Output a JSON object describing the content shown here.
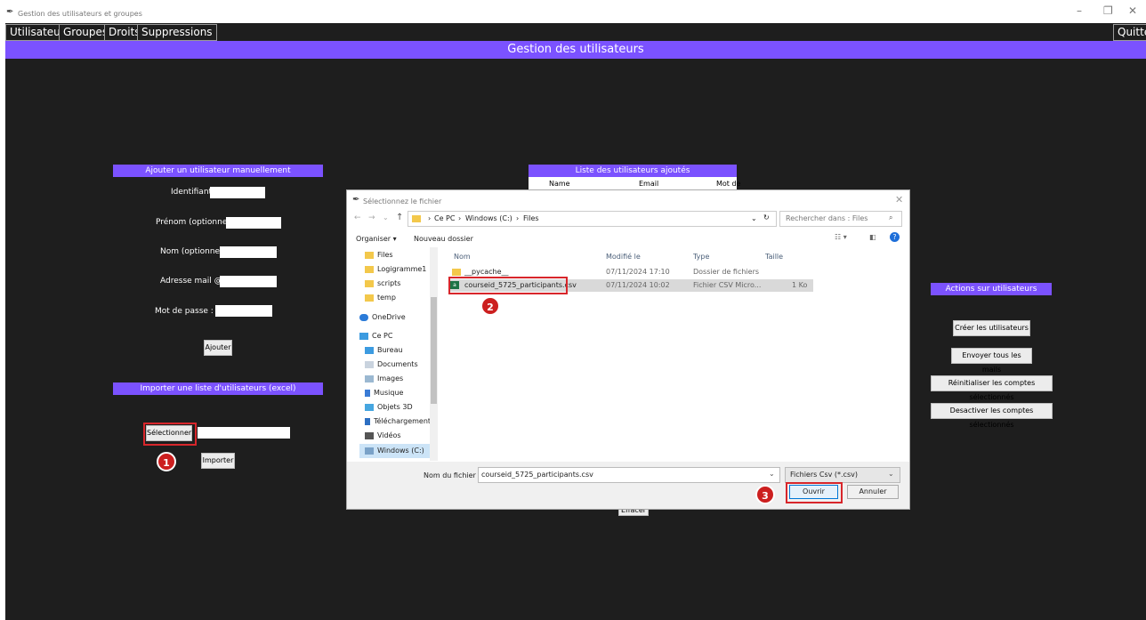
{
  "window": {
    "title": "Gestion des utilisateurs et groupes",
    "controls": [
      "–",
      "❐",
      "✕"
    ]
  },
  "menu": {
    "items": [
      "Utilisateurs",
      "Groupes",
      "Droits",
      "Suppressions"
    ],
    "quit": "Quitter"
  },
  "banner": "Gestion des utilisateurs",
  "manual": {
    "header": "Ajouter un utilisateur manuellement",
    "fields": {
      "id": "Identifiant :",
      "firstname": "Prénom (optionnel):",
      "lastname": "Nom (optionnel) :",
      "email": "Adresse mail @ :",
      "password": "Mot de passe :"
    },
    "add_button": "Ajouter"
  },
  "import": {
    "header": "Importer une liste d'utilisateurs (excel)",
    "select_button": "Sélectionner",
    "import_button": "Importer"
  },
  "list": {
    "header": "Liste des utilisateurs ajoutés",
    "columns": [
      "Name",
      "Email",
      "Mot de"
    ],
    "clear_button": "Effacer"
  },
  "actions": {
    "header": "Actions sur utilisateurs",
    "buttons": [
      "Créer les utilisateurs",
      "Envoyer tous les mails",
      "Réinitialiser les comptes sélectionnés",
      "Desactiver les comptes sélectionnés"
    ]
  },
  "dialog": {
    "title": "Sélectionnez le fichier",
    "path": [
      "Ce PC",
      "Windows (C:)",
      "Files"
    ],
    "search_placeholder": "Rechercher dans : Files",
    "organize": "Organiser ▾",
    "new_folder": "Nouveau dossier",
    "nav_items": [
      "Files",
      "Logigramme1",
      "scripts",
      "temp",
      "OneDrive",
      "Ce PC",
      "Bureau",
      "Documents",
      "Images",
      "Musique",
      "Objets 3D",
      "Téléchargements",
      "Vidéos",
      "Windows (C:)"
    ],
    "columns": [
      "Nom",
      "Modifié le",
      "Type",
      "Taille"
    ],
    "files": [
      {
        "name": "__pycache__",
        "modified": "07/11/2024 17:10",
        "type": "Dossier de fichiers",
        "size": ""
      },
      {
        "name": "courseid_5725_participants.csv",
        "modified": "07/11/2024 10:02",
        "type": "Fichier CSV Micro...",
        "size": "1 Ko"
      }
    ],
    "filename_label": "Nom du fichier :",
    "filename_value": "courseid_5725_participants.csv",
    "filter": "Fichiers Csv (*.csv)",
    "open_button": "Ouvrir",
    "cancel_button": "Annuler"
  },
  "badges": [
    "1",
    "2",
    "3"
  ],
  "colors": {
    "accent": "#7b52ff",
    "app_bg": "#1e1e1e",
    "highlight": "#d8262b"
  }
}
